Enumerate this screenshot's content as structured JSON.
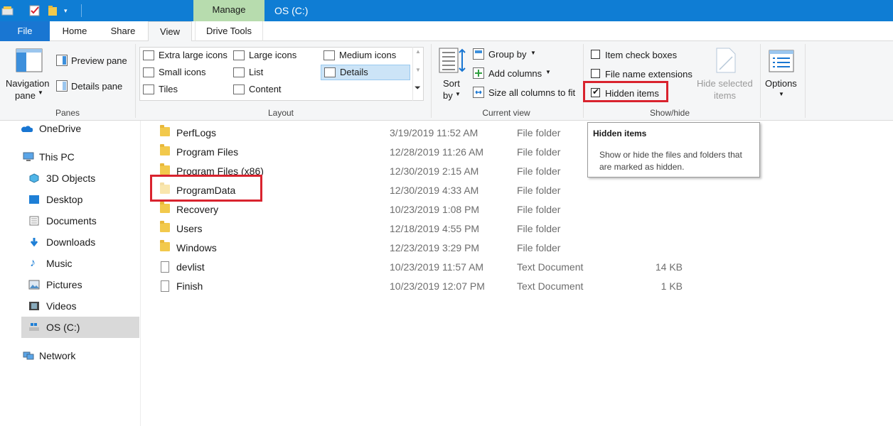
{
  "window": {
    "title": "OS (C:)",
    "contextual_tab": "Manage"
  },
  "tabs": [
    {
      "label": "File"
    },
    {
      "label": "Home"
    },
    {
      "label": "Share"
    },
    {
      "label": "View"
    },
    {
      "label": "Drive Tools"
    }
  ],
  "ribbon": {
    "panes": {
      "group_label": "Panes",
      "navigation_pane": "Navigation\npane",
      "navigation_pane_line1": "Navigation",
      "navigation_pane_line2": "pane",
      "preview_pane": "Preview pane",
      "details_pane": "Details pane"
    },
    "layout": {
      "group_label": "Layout",
      "items": [
        {
          "label": "Extra large icons"
        },
        {
          "label": "Large icons"
        },
        {
          "label": "Medium icons"
        },
        {
          "label": "Small icons"
        },
        {
          "label": "List"
        },
        {
          "label": "Details"
        },
        {
          "label": "Tiles"
        },
        {
          "label": "Content"
        }
      ],
      "selected": "Details"
    },
    "current_view": {
      "group_label": "Current view",
      "sort_line1": "Sort",
      "sort_line2": "by",
      "group_by": "Group by",
      "add_columns": "Add columns",
      "size_columns": "Size all columns to fit"
    },
    "show_hide": {
      "group_label": "Show/hide",
      "item_check_boxes": {
        "label": "Item check boxes",
        "checked": false
      },
      "file_name_extensions": {
        "label": "File name extensions",
        "checked": false
      },
      "hidden_items": {
        "label": "Hidden items",
        "checked": true
      },
      "hide_selected_line1": "Hide selected",
      "hide_selected_line2": "items"
    },
    "options": {
      "label": "Options"
    }
  },
  "tooltip": {
    "title": "Hidden items",
    "body": "Show or hide the files and folders that are marked as hidden."
  },
  "nav": {
    "items": [
      {
        "label": "OneDrive",
        "icon": "onedrive-icon"
      },
      {
        "label": "This PC",
        "icon": "computer-icon"
      },
      {
        "label": "3D Objects",
        "icon": "3d-objects-icon"
      },
      {
        "label": "Desktop",
        "icon": "desktop-icon"
      },
      {
        "label": "Documents",
        "icon": "documents-icon"
      },
      {
        "label": "Downloads",
        "icon": "downloads-icon"
      },
      {
        "label": "Music",
        "icon": "music-icon"
      },
      {
        "label": "Pictures",
        "icon": "pictures-icon"
      },
      {
        "label": "Videos",
        "icon": "videos-icon"
      },
      {
        "label": "OS (C:)",
        "icon": "drive-icon"
      },
      {
        "label": "Network",
        "icon": "network-icon"
      }
    ],
    "selected": "OS (C:)"
  },
  "files": [
    {
      "name": "PerfLogs",
      "date": "3/19/2019 11:52 AM",
      "type": "File folder",
      "size": "",
      "kind": "folder"
    },
    {
      "name": "Program Files",
      "date": "12/28/2019 11:26 AM",
      "type": "File folder",
      "size": "",
      "kind": "folder"
    },
    {
      "name": "Program Files (x86)",
      "date": "12/30/2019 2:15 AM",
      "type": "File folder",
      "size": "",
      "kind": "folder"
    },
    {
      "name": "ProgramData",
      "date": "12/30/2019 4:33 AM",
      "type": "File folder",
      "size": "",
      "kind": "folder",
      "hidden": true
    },
    {
      "name": "Recovery",
      "date": "10/23/2019 1:08 PM",
      "type": "File folder",
      "size": "",
      "kind": "folder"
    },
    {
      "name": "Users",
      "date": "12/18/2019 4:55 PM",
      "type": "File folder",
      "size": "",
      "kind": "folder"
    },
    {
      "name": "Windows",
      "date": "12/23/2019 3:29 PM",
      "type": "File folder",
      "size": "",
      "kind": "folder"
    },
    {
      "name": "devlist",
      "date": "10/23/2019 11:57 AM",
      "type": "Text Document",
      "size": "14 KB",
      "kind": "document"
    },
    {
      "name": "Finish",
      "date": "10/23/2019 12:07 PM",
      "type": "Text Document",
      "size": "1 KB",
      "kind": "document"
    }
  ],
  "colors": {
    "titlebar": "#0f7dd4",
    "file_tab": "#1976d2",
    "manage_tab": "#b7dcae",
    "highlight_box": "#d9232e",
    "selected_layout": "#cce4f7"
  }
}
